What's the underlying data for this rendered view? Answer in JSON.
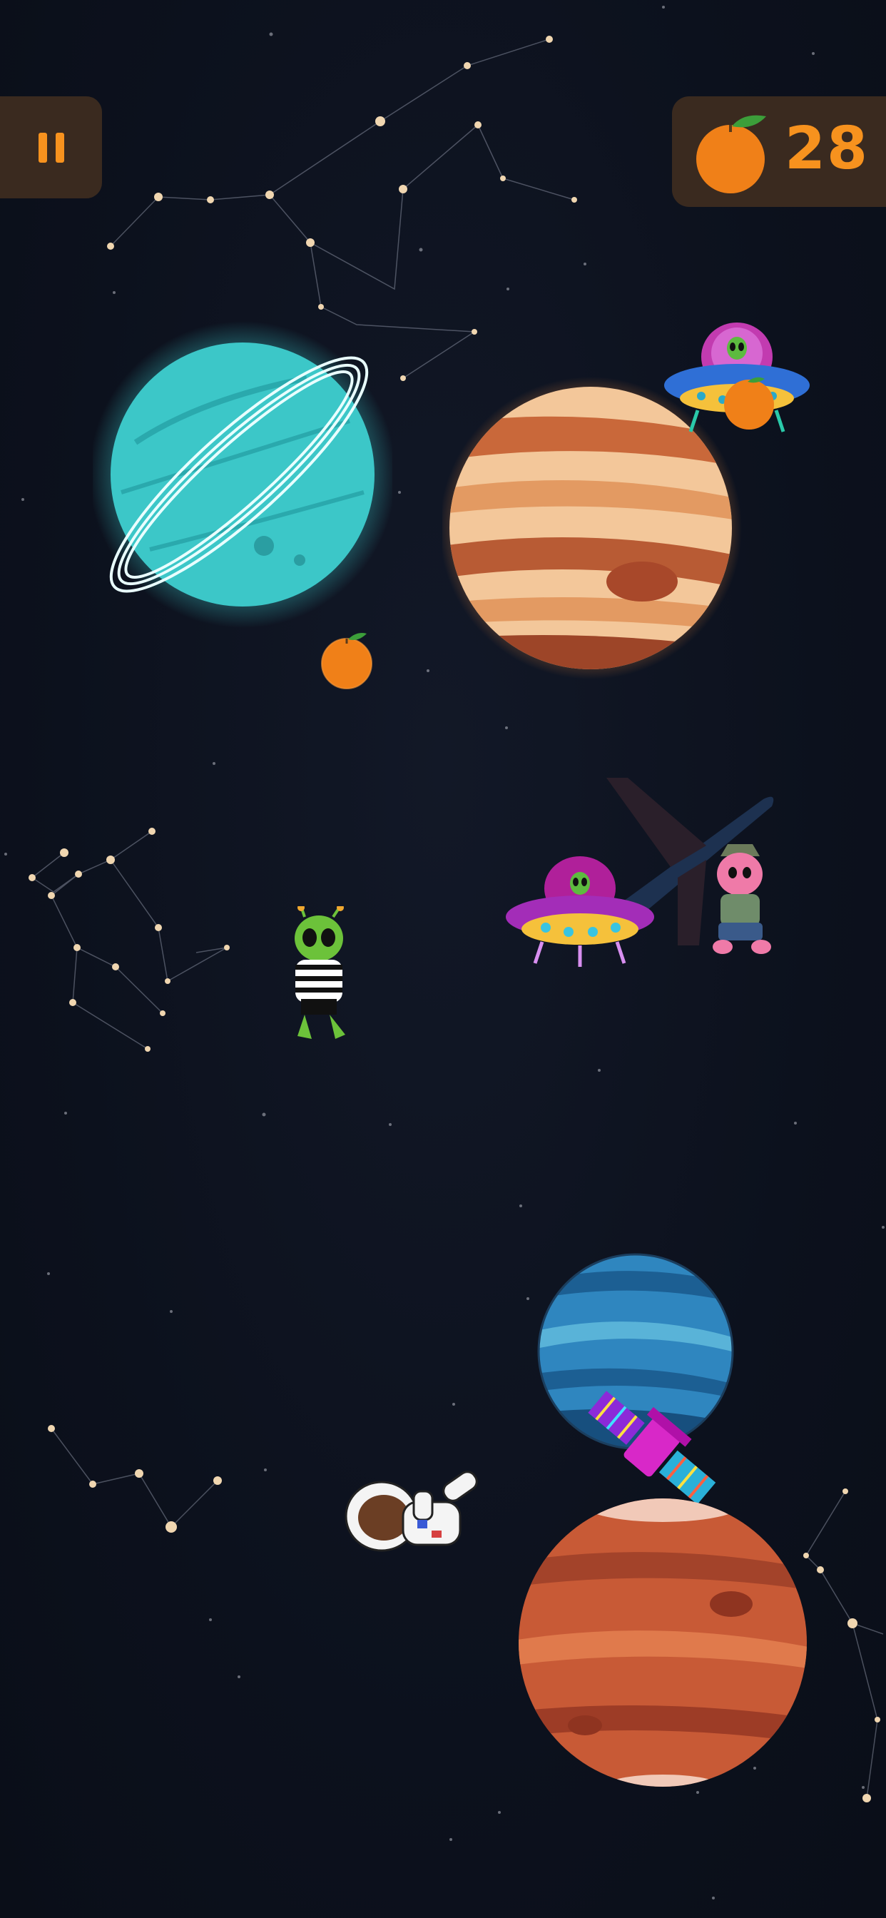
{
  "hud": {
    "pause_icon": "pause-icon",
    "score_icon": "orange-fruit-icon",
    "score": "28"
  },
  "colors": {
    "background": "#0c111d",
    "hud_panel": "#3a2a1f",
    "accent_orange": "#f7921e",
    "star": "#e9c9a0"
  },
  "sprites": {
    "planet_ringed_cyan": "ringed-cyan-planet",
    "planet_jupiter": "orange-gas-giant",
    "planet_blue": "blue-water-planet",
    "planet_mars": "red-mars-planet",
    "ufo_blue": "blue-ufo-with-alien",
    "ufo_purple": "purple-ufo-with-alien",
    "alien_green": "green-alien-striped-shirt",
    "alien_pink": "pink-alien-with-hat",
    "airplane": "dark-blue-airplane",
    "astronaut": "floating-astronaut",
    "satellite": "magenta-satellite",
    "orange_1": "orange-pickup",
    "orange_2": "orange-pickup"
  }
}
